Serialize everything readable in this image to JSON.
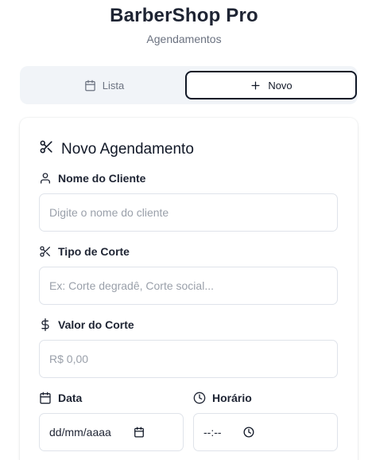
{
  "header": {
    "title": "BarberShop Pro",
    "subtitle": "Agendamentos"
  },
  "tabs": [
    {
      "label": "Lista",
      "icon": "calendar-icon",
      "selected": false
    },
    {
      "label": "Novo",
      "icon": "plus-icon",
      "selected": true
    }
  ],
  "form": {
    "title": "Novo Agendamento",
    "title_icon": "scissors-icon",
    "client_name": {
      "label": "Nome do Cliente",
      "icon": "user-icon",
      "placeholder": "Digite o nome do cliente",
      "value": ""
    },
    "cut_type": {
      "label": "Tipo de Corte",
      "icon": "scissors-icon",
      "placeholder": "Ex: Corte degradê, Corte social...",
      "value": ""
    },
    "cut_price": {
      "label": "Valor do Corte",
      "icon": "dollar-icon",
      "placeholder": "R$ 0,00",
      "value": ""
    },
    "date": {
      "label": "Data",
      "icon": "calendar-icon",
      "display": "dd/mm/aaaa"
    },
    "time": {
      "label": "Horário",
      "icon": "clock-icon",
      "display": "--:--"
    }
  },
  "colors": {
    "primary": "#111827",
    "muted_text": "#6b7280",
    "tab_background": "#f1f4f8",
    "input_border": "#dfe3ea"
  }
}
